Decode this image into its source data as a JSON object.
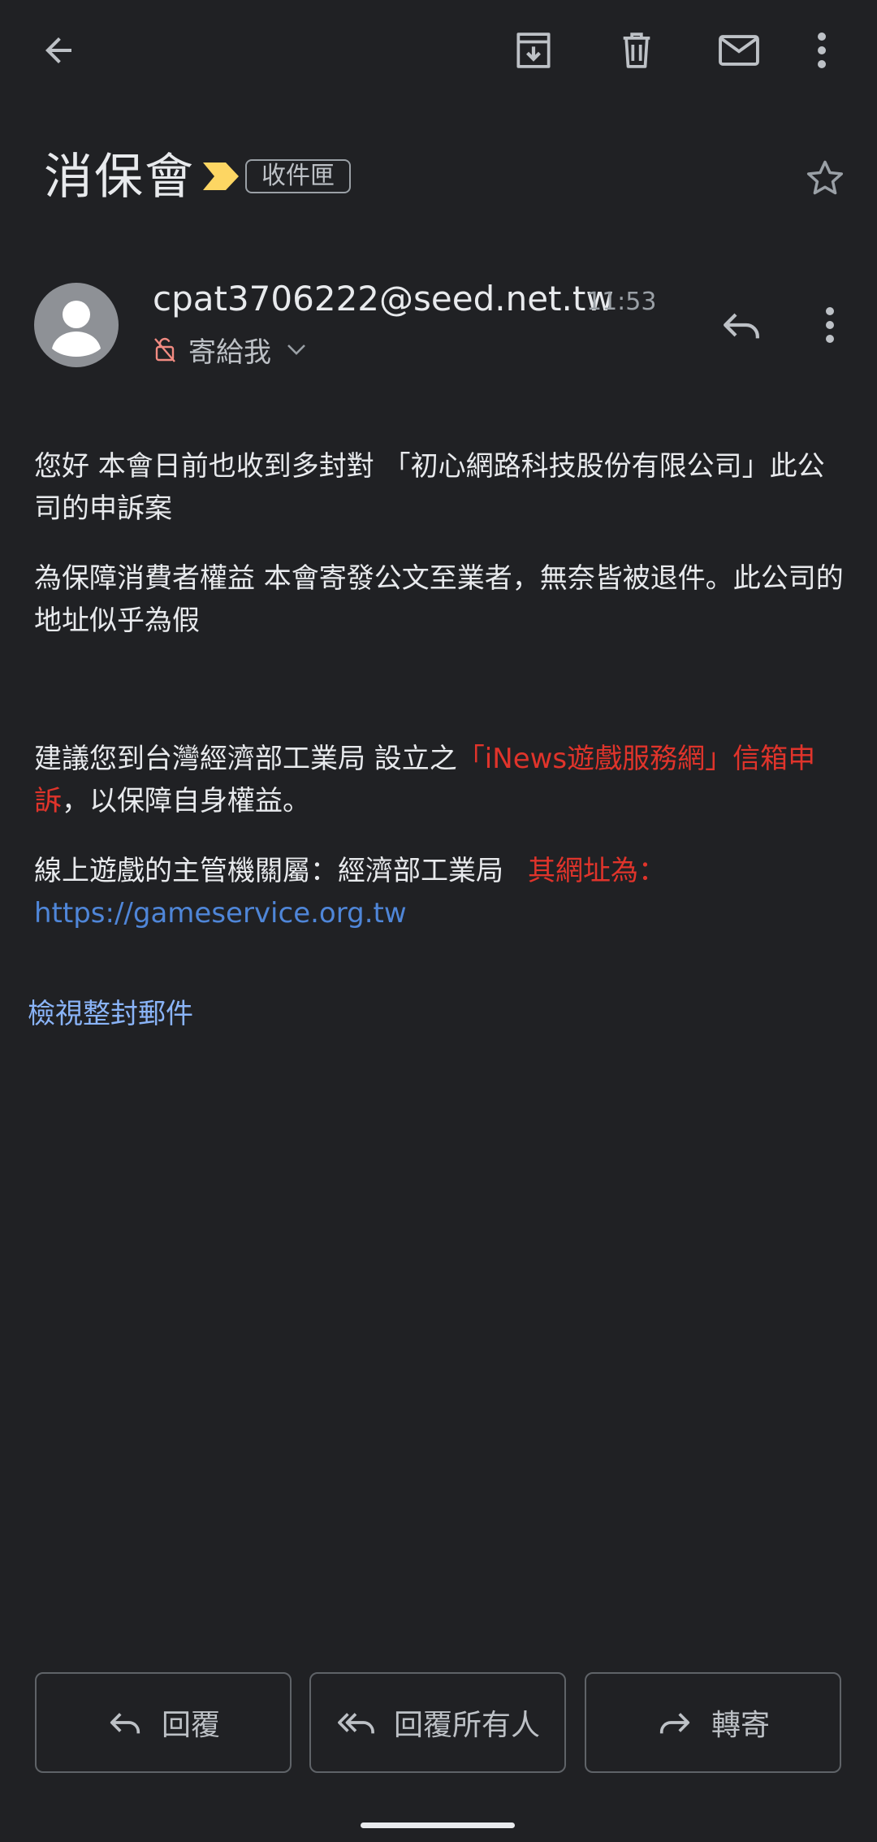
{
  "toolbar": {
    "back_icon": "arrow-back-icon",
    "archive_icon": "archive-icon",
    "delete_icon": "trash-icon",
    "mark_unread_icon": "mail-icon",
    "more_icon": "more-vert-icon"
  },
  "subject": {
    "title": "消保會",
    "label": "收件匣",
    "important_color": "#fdd663"
  },
  "sender": {
    "email": "cpat3706222@seed.net.tw",
    "time": "11:53",
    "recipient": "寄給我"
  },
  "body": {
    "p1": "您好 本會日前也收到多封對 「初心網路科技股份有限公司」此公司的申訴案",
    "p2": "為保障消費者權益 本會寄發公文至業者，無奈皆被退件。此公司的地址似乎為假",
    "p3_a": "建議您到台灣經濟部工業局 設立之",
    "p3_red": "「iNews遊戲服務網」信箱申訴",
    "p3_b": "，以保障自身權益。",
    "p4_a": "線上遊戲的主管機關屬：經濟部工業局",
    "p4_red": "其網址為：",
    "p4_link": "https://gameservice.org.tw",
    "view_all": "檢視整封郵件"
  },
  "actions": {
    "reply": "回覆",
    "reply_all": "回覆所有人",
    "forward": "轉寄"
  },
  "colors": {
    "background": "#202124",
    "red_text": "#e0342b",
    "link": "#4f86d8"
  }
}
